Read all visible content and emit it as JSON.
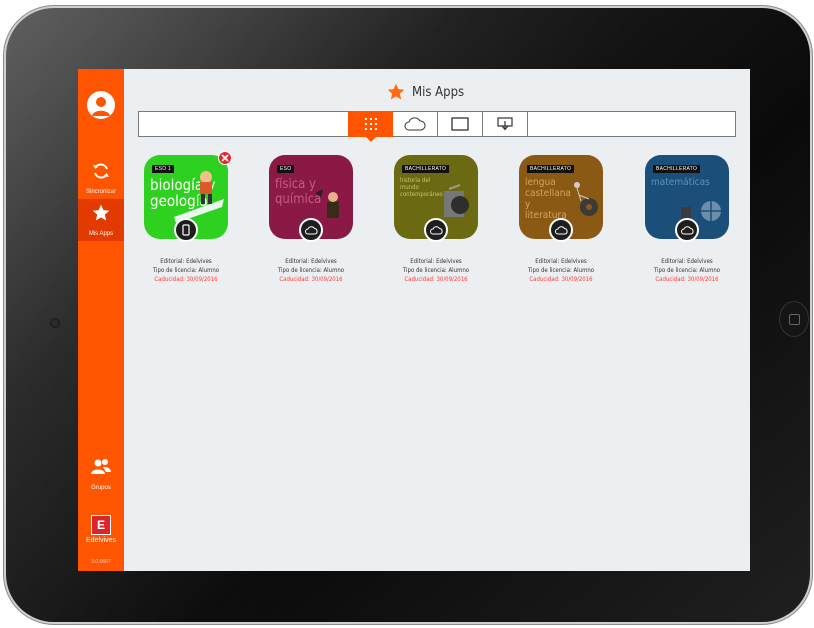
{
  "header": {
    "title": "Mis Apps"
  },
  "sidebar": {
    "items": [
      {
        "label": "Sincronizar"
      },
      {
        "label": "Mis Apps"
      },
      {
        "label": "Grupos"
      },
      {
        "label": "Edelvives"
      }
    ],
    "edelvives_letter": "E",
    "version": "3.0.0667"
  },
  "toolbar": {
    "views": [
      "grid-icon",
      "cloud-icon",
      "tablet-icon",
      "download-icon"
    ],
    "active_view": "grid-icon"
  },
  "apps": [
    {
      "tag": "ESO 1",
      "title": "biología y geología",
      "color": "#2ed11f",
      "status": "device",
      "editorial": "Editorial: Edelvives",
      "license": "Tipo de licencia: Alumno",
      "expiry": "Caducidad: 30/09/2016"
    },
    {
      "tag": "ESO",
      "title": "física y química",
      "color": "#8a1a45",
      "status": "cloud",
      "editorial": "Editorial: Edelvives",
      "license": "Tipo de licencia: Alumno",
      "expiry": "Caducidad: 30/09/2016"
    },
    {
      "tag": "BACHILLERATO",
      "title": "historia del mundo contemporáneo",
      "color": "#6b6a12",
      "status": "cloud",
      "editorial": "Editorial: Edelvives",
      "license": "Tipo de licencia: Alumno",
      "expiry": "Caducidad: 30/09/2016"
    },
    {
      "tag": "BACHILLERATO",
      "title": "lengua castellana y literatura",
      "color": "#8a5a14",
      "status": "cloud",
      "editorial": "Editorial: Edelvives",
      "license": "Tipo de licencia: Alumno",
      "expiry": "Caducidad: 30/09/2016"
    },
    {
      "tag": "BACHILLERATO",
      "title": "matemáticas",
      "color": "#1b4f7a",
      "status": "cloud",
      "editorial": "Editorial: Edelvives",
      "license": "Tipo de licencia: Alumno",
      "expiry": "Caducidad: 30/09/2016"
    }
  ],
  "colors": {
    "accent": "#ff5500",
    "expiry": "#ff3b3b",
    "delete": "#e8262b"
  }
}
